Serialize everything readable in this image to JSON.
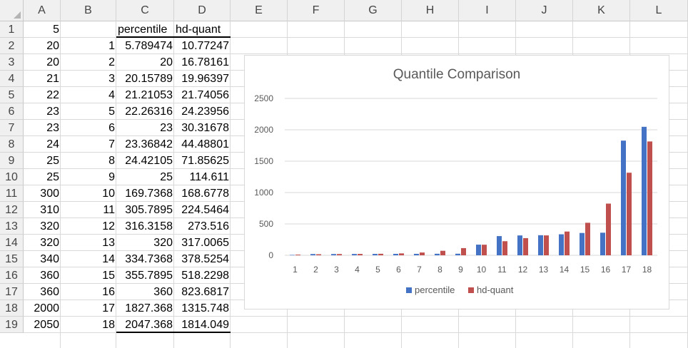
{
  "spreadsheet": {
    "column_headers": [
      "A",
      "B",
      "C",
      "D",
      "E",
      "F",
      "G",
      "H",
      "I",
      "J",
      "K",
      "L"
    ],
    "row_headers": [
      "1",
      "2",
      "3",
      "4",
      "5",
      "6",
      "7",
      "8",
      "9",
      "10",
      "11",
      "12",
      "13",
      "14",
      "15",
      "16",
      "17",
      "18",
      "19"
    ],
    "rows": [
      [
        "5",
        "",
        "percentile",
        "hd-quant"
      ],
      [
        "20",
        "1",
        "5.789474",
        "10.77247"
      ],
      [
        "20",
        "2",
        "20",
        "16.78161"
      ],
      [
        "21",
        "3",
        "20.15789",
        "19.96397"
      ],
      [
        "22",
        "4",
        "21.21053",
        "21.74056"
      ],
      [
        "23",
        "5",
        "22.26316",
        "24.23956"
      ],
      [
        "23",
        "6",
        "23",
        "30.31678"
      ],
      [
        "24",
        "7",
        "23.36842",
        "44.48801"
      ],
      [
        "25",
        "8",
        "24.42105",
        "71.85625"
      ],
      [
        "25",
        "9",
        "25",
        "114.611"
      ],
      [
        "300",
        "10",
        "169.7368",
        "168.6778"
      ],
      [
        "310",
        "11",
        "305.7895",
        "224.5464"
      ],
      [
        "320",
        "12",
        "316.3158",
        "273.516"
      ],
      [
        "320",
        "13",
        "320",
        "317.0065"
      ],
      [
        "340",
        "14",
        "334.7368",
        "378.5254"
      ],
      [
        "360",
        "15",
        "355.7895",
        "518.2298"
      ],
      [
        "360",
        "16",
        "360",
        "823.6817"
      ],
      [
        "2000",
        "17",
        "1827.368",
        "1315.748"
      ],
      [
        "2050",
        "18",
        "2047.368",
        "1814.049"
      ]
    ]
  },
  "chart_data": {
    "type": "bar",
    "title": "Quantile Comparison",
    "categories": [
      "1",
      "2",
      "3",
      "4",
      "5",
      "6",
      "7",
      "8",
      "9",
      "10",
      "11",
      "12",
      "13",
      "14",
      "15",
      "16",
      "17",
      "18"
    ],
    "series": [
      {
        "name": "percentile",
        "color": "#4472c4",
        "values": [
          5.789474,
          20,
          20.15789,
          21.21053,
          22.26316,
          23,
          23.36842,
          24.42105,
          25,
          169.7368,
          305.7895,
          316.3158,
          320,
          334.7368,
          355.7895,
          360,
          1827.368,
          2047.368
        ]
      },
      {
        "name": "hd-quant",
        "color": "#c0504d",
        "values": [
          10.77247,
          16.78161,
          19.96397,
          21.74056,
          24.23956,
          30.31678,
          44.48801,
          71.85625,
          114.611,
          168.6778,
          224.5464,
          273.516,
          317.0065,
          378.5254,
          518.2298,
          823.6817,
          1315.748,
          1814.049
        ]
      }
    ],
    "yticks": [
      "0",
      "500",
      "1000",
      "1500",
      "2000",
      "2500"
    ],
    "ylim": [
      0,
      2500
    ],
    "grid": true,
    "legend": "bottom"
  }
}
